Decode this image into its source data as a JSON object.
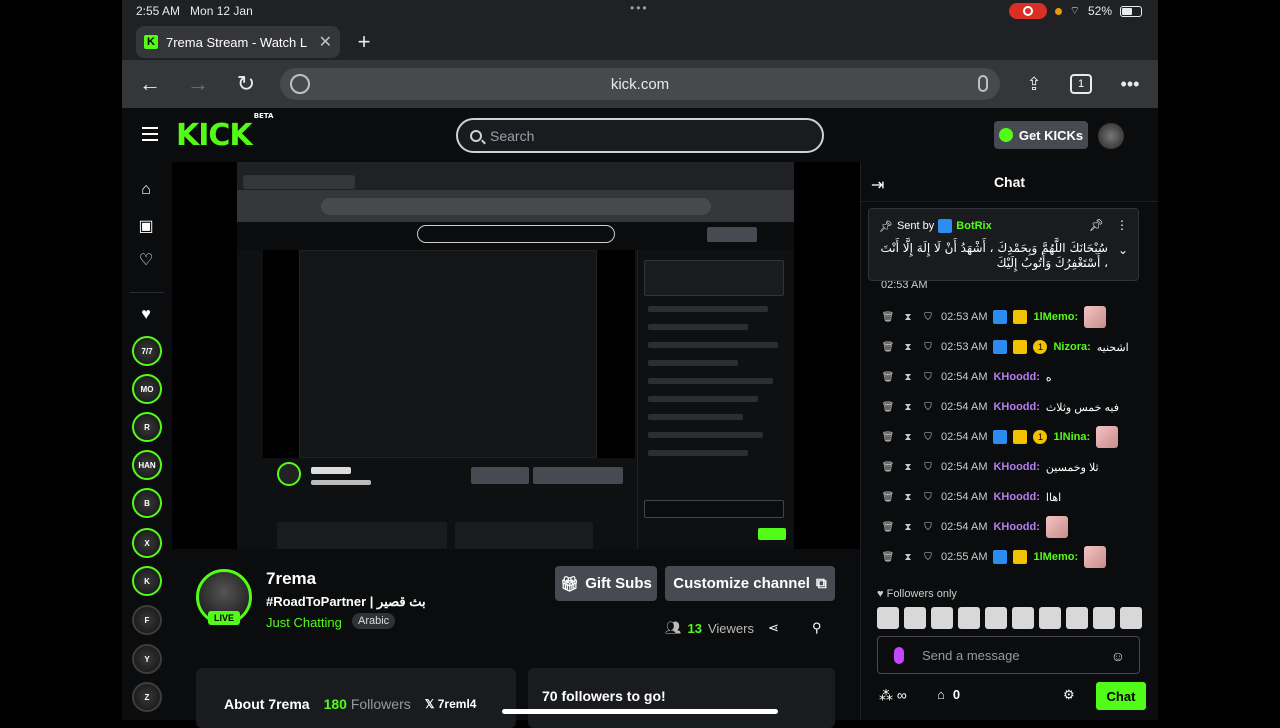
{
  "status": {
    "time": "2:55 AM",
    "date": "Mon 12 Jan",
    "battery": "52%"
  },
  "browser": {
    "tab_title": "7rema Stream - Watch L",
    "url": "kick.com",
    "tab_count": "1"
  },
  "kick": {
    "logo": "KICK",
    "beta": "BETA",
    "search_placeholder": "Search",
    "get_kicks": "Get KICKs"
  },
  "sidebar": {
    "channels": [
      "7/7",
      "MO",
      "R",
      "HAN",
      "B",
      "X",
      "K",
      "F",
      "Y",
      "Z"
    ]
  },
  "stream": {
    "channel": "7rema",
    "title": "#RoadToPartner | بث قصير",
    "category": "Just Chatting",
    "language": "Arabic",
    "live": "LIVE",
    "gift_subs": "Gift Subs",
    "customize": "Customize channel",
    "viewers_count": "13",
    "viewers_label": "Viewers",
    "about": "About 7rema",
    "followers_count": "180",
    "followers_label": "Followers",
    "x_handle": "7reml4",
    "goal": "70 followers to go!"
  },
  "chat": {
    "title": "Chat",
    "pinned_by_label": "Sent by",
    "pinned_user": "BotRix",
    "pinned_message": "سُبْحَانَكَ اللَّهُمَّ وَبِحَمْدِكَ ، أَشْهَدُ أَنْ لَا إِلَهَ إِلَّا أَنْتَ ، أَسْتَغْفِرُكَ وَأَتُوبُ إِلَيْكَ",
    "messages": [
      {
        "time": "02:53 AM",
        "user": "1lMemo:",
        "color": "#53fc18",
        "text": "",
        "badges": "mv"
      },
      {
        "time": "02:53 AM",
        "user": "Nizora:",
        "color": "#53fc18",
        "text": "اشحنيه",
        "badges": "mvs"
      },
      {
        "time": "02:54 AM",
        "user": "KHoodd:",
        "color": "#b37feb",
        "text": "ه",
        "badges": ""
      },
      {
        "time": "02:54 AM",
        "user": "KHoodd:",
        "color": "#b37feb",
        "text": "فيه خمس وثلاث",
        "badges": ""
      },
      {
        "time": "02:54 AM",
        "user": "1lNina:",
        "color": "#53fc18",
        "text": "",
        "badges": "mvs"
      },
      {
        "time": "02:54 AM",
        "user": "KHoodd:",
        "color": "#b37feb",
        "text": "ثلا وخمسين",
        "badges": ""
      },
      {
        "time": "02:54 AM",
        "user": "KHoodd:",
        "color": "#b37feb",
        "text": "اهاا",
        "badges": ""
      },
      {
        "time": "02:54 AM",
        "user": "KHoodd:",
        "color": "#b37feb",
        "text": "",
        "badges": ""
      },
      {
        "time": "02:55 AM",
        "user": "1lMemo:",
        "color": "#53fc18",
        "text": "",
        "badges": "mv"
      }
    ],
    "partial_top": "02:53 AM",
    "followers_only": "Followers only",
    "input_placeholder": "Send a message",
    "kicks_count": "0",
    "chat_button": "Chat"
  }
}
